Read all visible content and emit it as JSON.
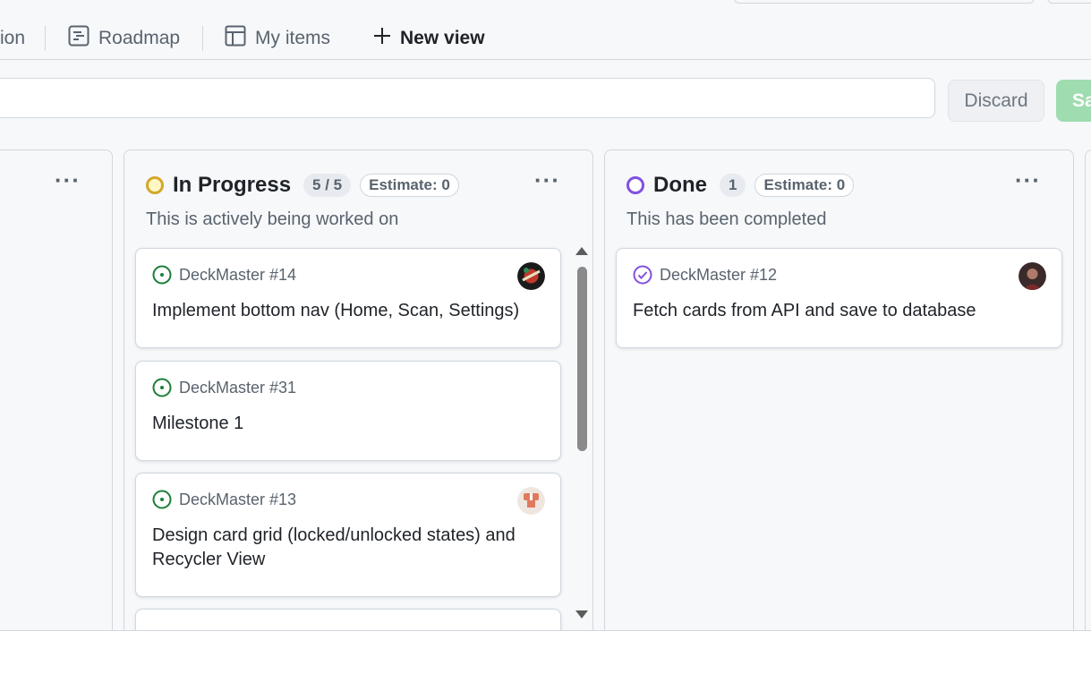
{
  "tabs": [
    {
      "label": "ion",
      "icon": "none"
    },
    {
      "label": "Roadmap",
      "icon": "roadmap-icon"
    },
    {
      "label": "My items",
      "icon": "table-icon"
    },
    {
      "label": "New view",
      "icon": "plus-icon"
    }
  ],
  "filter": {
    "placeholder": ""
  },
  "actions": {
    "discard": "Discard",
    "save": "Sa"
  },
  "columns": [
    {
      "title": "In Progress",
      "count": "5 / 5",
      "estimate": "Estimate: 0",
      "description": "This is actively being worked on",
      "status_color": "#d4a72c",
      "status_fill": "#fff8c5",
      "cards": [
        {
          "ref": "DeckMaster #14",
          "title": "Implement bottom nav (Home, Scan, Settings)",
          "state": "open"
        },
        {
          "ref": "DeckMaster #31",
          "title": "Milestone 1",
          "state": "open"
        },
        {
          "ref": "DeckMaster #13",
          "title": "Design card grid (locked/unlocked states) and Recycler View",
          "state": "open"
        }
      ]
    },
    {
      "title": "Done",
      "count": "1",
      "estimate": "Estimate: 0",
      "description": "This has been completed",
      "status_color": "#8250df",
      "status_fill": "#ffffff",
      "cards": [
        {
          "ref": "DeckMaster #12",
          "title": "Fetch cards from API and save to database",
          "state": "closed"
        }
      ]
    }
  ],
  "colors": {
    "open": "#1a7f37",
    "closed": "#8250df",
    "save_button": "#9fdcaf"
  }
}
